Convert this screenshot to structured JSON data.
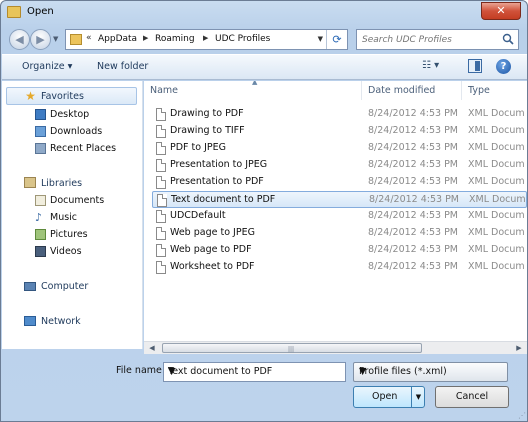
{
  "window": {
    "title": "Open",
    "close_symbol": "✕"
  },
  "navigation": {
    "back_symbol": "◀",
    "forward_symbol": "▶",
    "breadcrumb": [
      "AppData",
      "Roaming",
      "UDC Profiles"
    ],
    "breadcrumb_prefix": "«",
    "separator": "▶",
    "refresh_symbol": "⟳"
  },
  "search": {
    "placeholder": "Search UDC Profiles"
  },
  "toolbar": {
    "organize_label": "Organize ▾",
    "new_folder_label": "New folder",
    "views_symbol": "☷ ▾",
    "help_symbol": "?"
  },
  "sidebar": {
    "favorites": {
      "label": "Favorites",
      "items": [
        "Desktop",
        "Downloads",
        "Recent Places"
      ]
    },
    "libraries": {
      "label": "Libraries",
      "items": [
        "Documents",
        "Music",
        "Pictures",
        "Videos"
      ]
    },
    "computer": {
      "label": "Computer"
    },
    "network": {
      "label": "Network"
    }
  },
  "columns": {
    "name": "Name",
    "date": "Date modified",
    "type": "Type"
  },
  "files": [
    {
      "name": "Drawing to PDF",
      "date": "8/24/2012 4:53 PM",
      "type": "XML Docum"
    },
    {
      "name": "Drawing to TIFF",
      "date": "8/24/2012 4:53 PM",
      "type": "XML Docum"
    },
    {
      "name": "PDF to JPEG",
      "date": "8/24/2012 4:53 PM",
      "type": "XML Docum"
    },
    {
      "name": "Presentation to JPEG",
      "date": "8/24/2012 4:53 PM",
      "type": "XML Docum"
    },
    {
      "name": "Presentation to PDF",
      "date": "8/24/2012 4:53 PM",
      "type": "XML Docum"
    },
    {
      "name": "Text document to PDF",
      "date": "8/24/2012 4:53 PM",
      "type": "XML Docum"
    },
    {
      "name": "UDCDefault",
      "date": "8/24/2012 4:53 PM",
      "type": "XML Docum"
    },
    {
      "name": "Web page to JPEG",
      "date": "8/24/2012 4:53 PM",
      "type": "XML Docum"
    },
    {
      "name": "Web page to PDF",
      "date": "8/24/2012 4:53 PM",
      "type": "XML Docum"
    },
    {
      "name": "Worksheet to PDF",
      "date": "8/24/2012 4:53 PM",
      "type": "XML Docum"
    }
  ],
  "selected_file_index": 5,
  "bottom": {
    "file_name_label": "File name:",
    "file_name_value": "Text document to PDF",
    "filter_value": "Profile files (*.xml)",
    "open_label": "Open",
    "cancel_label": "Cancel"
  },
  "colors": {
    "accent": "#3c7fb1",
    "selection": "#d6e7f8",
    "chrome": "#bdd3ec"
  }
}
